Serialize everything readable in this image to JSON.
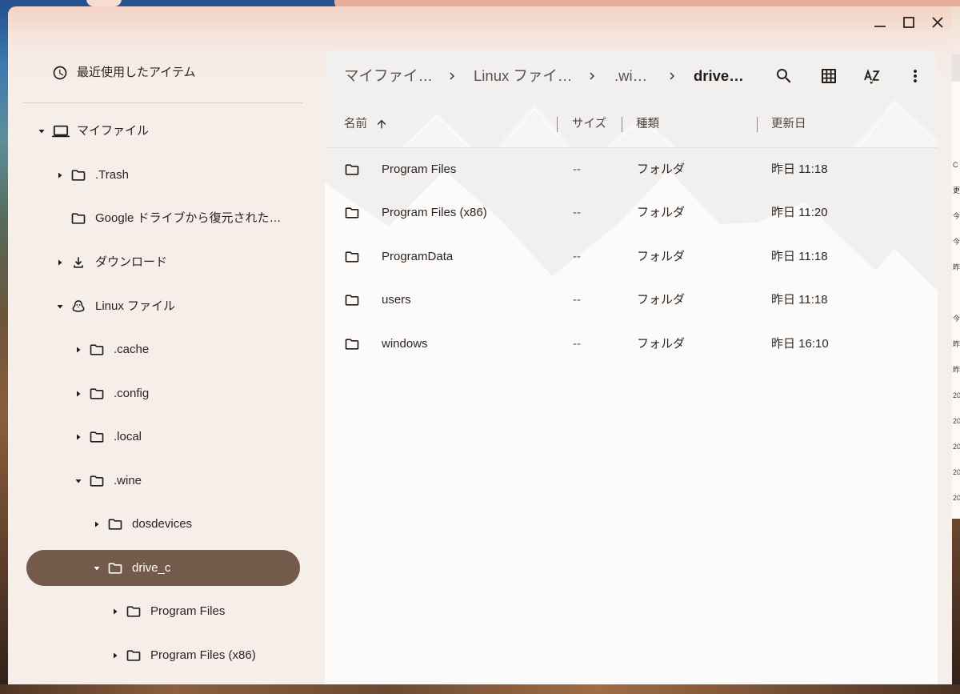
{
  "window_controls": {
    "minimize_icon": "minimize-icon",
    "maximize_icon": "maximize-icon",
    "close_icon": "close-icon"
  },
  "sidebar": {
    "recent": {
      "label": "最近使用したアイテム",
      "icon": "clock-icon"
    },
    "tree": [
      {
        "label": "マイファイル",
        "icon": "laptop-icon",
        "state": "expanded",
        "level": 0
      },
      {
        "label": ".Trash",
        "icon": "folder-icon",
        "state": "collapsed",
        "level": 1
      },
      {
        "label": "Google ドライブから復元された…",
        "icon": "folder-icon",
        "state": "leaf",
        "level": 1
      },
      {
        "label": "ダウンロード",
        "icon": "download-icon",
        "state": "collapsed",
        "level": 1
      },
      {
        "label": "Linux ファイル",
        "icon": "linux-icon",
        "state": "expanded",
        "level": 1
      },
      {
        "label": ".cache",
        "icon": "folder-icon",
        "state": "collapsed",
        "level": 2
      },
      {
        "label": ".config",
        "icon": "folder-icon",
        "state": "collapsed",
        "level": 2
      },
      {
        "label": ".local",
        "icon": "folder-icon",
        "state": "collapsed",
        "level": 2
      },
      {
        "label": ".wine",
        "icon": "folder-icon",
        "state": "expanded",
        "level": 2
      },
      {
        "label": "dosdevices",
        "icon": "folder-icon",
        "state": "collapsed",
        "level": 3
      },
      {
        "label": "drive_c",
        "icon": "folder-icon",
        "state": "expanded",
        "level": 3,
        "selected": true
      },
      {
        "label": "Program Files",
        "icon": "folder-icon",
        "state": "collapsed",
        "level": 4
      },
      {
        "label": "Program Files (x86)",
        "icon": "folder-icon",
        "state": "collapsed",
        "level": 4
      }
    ]
  },
  "breadcrumb": [
    {
      "label": "マイファイ…"
    },
    {
      "label": "Linux ファイ…"
    },
    {
      "label": ".wi…"
    },
    {
      "label": "drive…",
      "current": true
    }
  ],
  "toolbar": {
    "search_icon": "search-icon",
    "grid_icon": "grid-view-icon",
    "sort_icon": "sort-az-icon",
    "more_icon": "more-vert-icon"
  },
  "file_list": {
    "columns": {
      "name": "名前",
      "size": "サイズ",
      "type": "種類",
      "modified": "更新日"
    },
    "sort": {
      "column": "名前",
      "direction": "ascending"
    },
    "rows": [
      {
        "name": "Program Files",
        "size": "--",
        "type": "フォルダ",
        "modified": "昨日 11:18",
        "icon": "folder-icon"
      },
      {
        "name": "Program Files (x86)",
        "size": "--",
        "type": "フォルダ",
        "modified": "昨日 11:20",
        "icon": "folder-icon"
      },
      {
        "name": "ProgramData",
        "size": "--",
        "type": "フォルダ",
        "modified": "昨日 11:18",
        "icon": "folder-icon"
      },
      {
        "name": "users",
        "size": "--",
        "type": "フォルダ",
        "modified": "昨日 11:18",
        "icon": "folder-icon"
      },
      {
        "name": "windows",
        "size": "--",
        "type": "フォルダ",
        "modified": "昨日 16:10",
        "icon": "folder-icon"
      }
    ]
  },
  "colors": {
    "selected_background": "#735a4b",
    "sidebar_background": "#f6eee9",
    "title_gradient": "#f2d2c3",
    "panel_background": "#fcfbfa"
  },
  "background_window": {
    "fragments": [
      "C",
      "更",
      "今",
      "今",
      "昨",
      "今",
      "昨",
      "昨",
      "20",
      "20",
      "20",
      "20",
      "20"
    ]
  }
}
